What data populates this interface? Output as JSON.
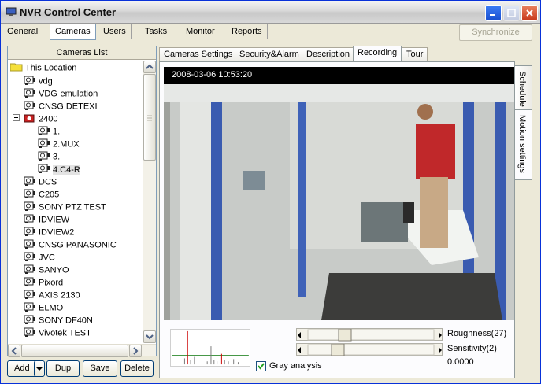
{
  "window": {
    "title": "NVR Control Center"
  },
  "menu": {
    "tabs": [
      "General",
      "Cameras",
      "Users",
      "Tasks",
      "Monitor",
      "Reports"
    ],
    "active": "Cameras",
    "sync_label": "Synchronize"
  },
  "cameras_list": {
    "header": "Cameras List",
    "items": [
      {
        "label": "This Location",
        "type": "folder"
      },
      {
        "label": "vdg",
        "type": "camera"
      },
      {
        "label": "VDG-emulation",
        "type": "camera"
      },
      {
        "label": "CNSG DETEXI",
        "type": "camera"
      },
      {
        "label": "2400",
        "type": "group",
        "expanded": true
      },
      {
        "label": "1.",
        "type": "camera"
      },
      {
        "label": "2.MUX",
        "type": "camera"
      },
      {
        "label": "3.",
        "type": "camera"
      },
      {
        "label": "4.C4-R",
        "type": "camera",
        "selected": true
      },
      {
        "label": "DCS",
        "type": "camera"
      },
      {
        "label": "C205",
        "type": "camera"
      },
      {
        "label": "SONY PTZ TEST",
        "type": "camera"
      },
      {
        "label": "IDVIEW",
        "type": "camera"
      },
      {
        "label": "IDVIEW2",
        "type": "camera"
      },
      {
        "label": "CNSG PANASONIC",
        "type": "camera"
      },
      {
        "label": "JVC",
        "type": "camera"
      },
      {
        "label": "SANYO",
        "type": "camera"
      },
      {
        "label": "Pixord",
        "type": "camera"
      },
      {
        "label": "AXIS 2130",
        "type": "camera"
      },
      {
        "label": "ELMO",
        "type": "camera"
      },
      {
        "label": "SONY DF40N",
        "type": "camera"
      },
      {
        "label": "Vivotek TEST",
        "type": "camera"
      }
    ]
  },
  "buttons": {
    "add": "Add",
    "dup": "Dup",
    "save": "Save",
    "delete": "Delete"
  },
  "camera_tabs": {
    "items": [
      "Cameras Settings",
      "Security&Alarm",
      "Description",
      "Recording",
      "Tour"
    ],
    "active": "Recording"
  },
  "side_tabs": {
    "schedule": "Schedule",
    "motion": "Motion settings"
  },
  "video": {
    "timestamp": "2008-03-06 10:53:20"
  },
  "motion": {
    "roughness_label": "Roughness(27)",
    "roughness_value": 27,
    "sensitivity_label": "Sensitivity(2)",
    "sensitivity_value": 2,
    "level_value": "0.0000",
    "gray_label": "Gray analysis",
    "gray_checked": true
  },
  "colors": {
    "accent": "#0831d9",
    "histogram_spike": "#cc0000",
    "threshold_line": "#2d8a2d"
  }
}
